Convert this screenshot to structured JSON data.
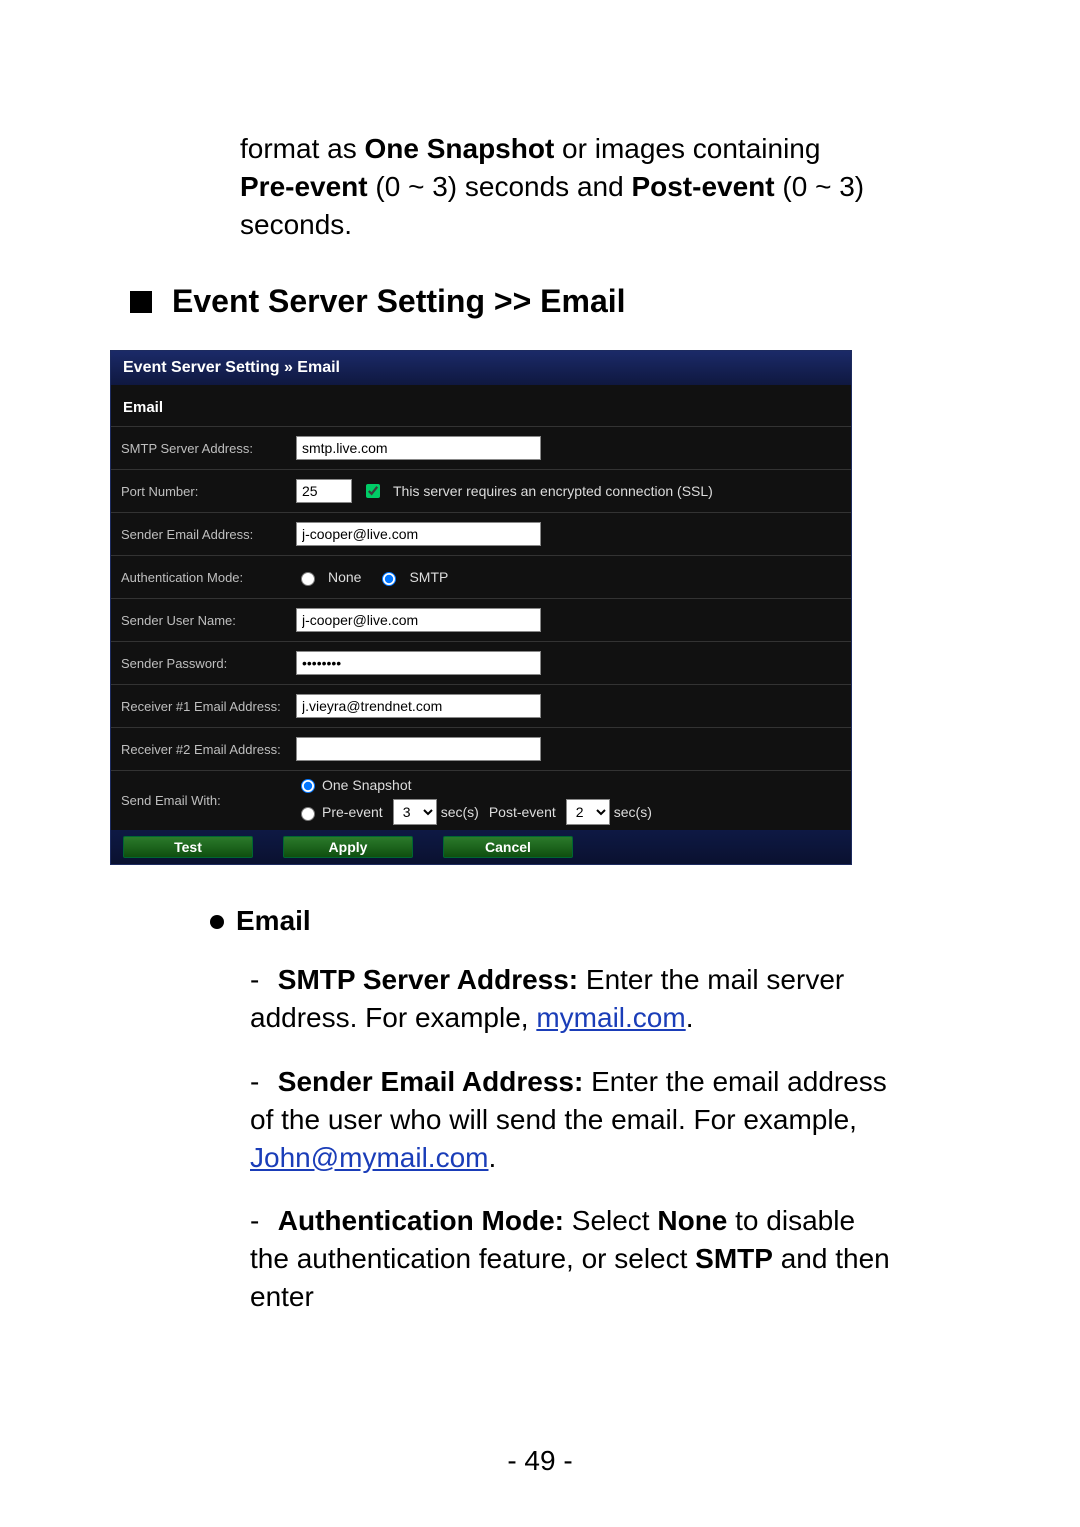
{
  "intro": {
    "prefix": "format as ",
    "bold1": "One Snapshot",
    "mid1": " or images containing ",
    "bold2": "Pre-event",
    "mid2": " (0 ~ 3) seconds and ",
    "bold3": "Post-event",
    "suffix": " (0 ~ 3) seconds."
  },
  "heading": "Event Server Setting >> Email",
  "panel": {
    "title": "Event Server Setting » Email",
    "section": "Email",
    "labels": {
      "smtp": "SMTP Server Address:",
      "port": "Port Number:",
      "sender_addr": "Sender Email Address:",
      "auth_mode": "Authentication Mode:",
      "sender_user": "Sender User Name:",
      "sender_pass": "Sender Password:",
      "recv1": "Receiver #1 Email Address:",
      "recv2": "Receiver #2 Email Address:",
      "send_with": "Send Email With:"
    },
    "values": {
      "smtp": "smtp.live.com",
      "port": "25",
      "ssl_checked": true,
      "ssl_label": "This server requires an encrypted connection (SSL)",
      "sender_addr": "j-cooper@live.com",
      "auth_none": "None",
      "auth_smtp": "SMTP",
      "auth_selected": "smtp",
      "sender_user": "j-cooper@live.com",
      "sender_pass": "••••••••",
      "recv1": "j.vieyra@trendnet.com",
      "recv2": "",
      "one_snapshot_label": "One Snapshot",
      "pre_event_label": "Pre-event",
      "pre_event_value": "3",
      "secs1": "sec(s)",
      "post_event_label": "Post-event",
      "post_event_value": "2",
      "secs2": "sec(s)"
    },
    "buttons": {
      "test": "Test",
      "apply": "Apply",
      "cancel": "Cancel"
    }
  },
  "desc": {
    "heading": "Email",
    "items": [
      {
        "bold": "SMTP Server Address:",
        "text": " Enter the mail server address. For example, ",
        "link": "mymail.com",
        "tail": "."
      },
      {
        "bold": "Sender Email Address:",
        "text": " Enter the email address of the user who will send the email. For example, ",
        "link": "John@mymail.com",
        "tail": "."
      },
      {
        "bold": "Authentication Mode:",
        "text": " Select ",
        "bold2": "None",
        "text2": " to disable the authentication feature, or select ",
        "bold3": "SMTP",
        "text3": " and then enter"
      }
    ]
  },
  "page_number": "- 49 -"
}
